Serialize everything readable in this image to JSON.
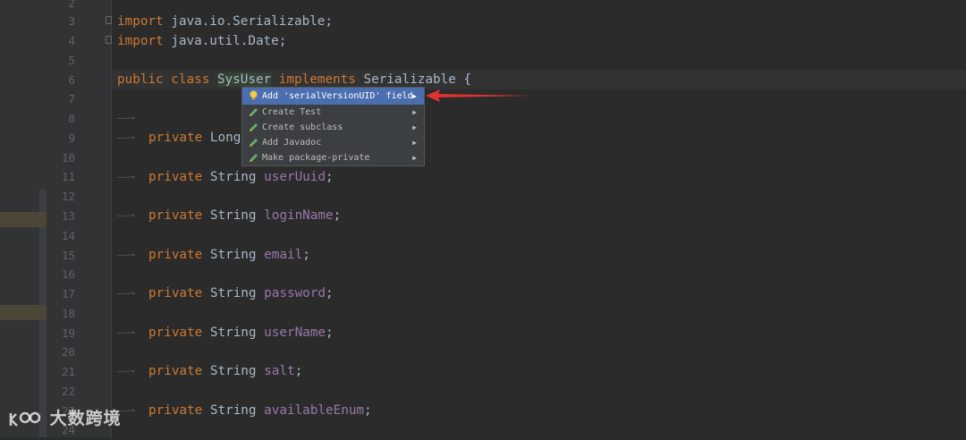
{
  "editor": {
    "line_numbers": [
      "2",
      "3",
      "4",
      "5",
      "6",
      "7",
      "8",
      "9",
      "10",
      "11",
      "12",
      "13",
      "14",
      "15",
      "16",
      "17",
      "18",
      "19",
      "20",
      "21",
      "22",
      "23",
      "24"
    ],
    "lines": {
      "l3": {
        "kw": "import",
        "rest": " java.io.Serializable;"
      },
      "l4": {
        "kw": "import",
        "rest": " java.util.Date;"
      },
      "l6": {
        "kw1": "public",
        "kw2": "class",
        "classname": "SysUser",
        "kw3": "implements",
        "rest": " Serializable {"
      },
      "l9": {
        "kw": "private",
        "type": " Long"
      },
      "l11": {
        "kw": "private",
        "type": " String ",
        "field": "userUuid",
        "end": ";"
      },
      "l13": {
        "kw": "private",
        "type": " String ",
        "field": "loginName",
        "end": ";"
      },
      "l15": {
        "kw": "private",
        "type": " String ",
        "field": "email",
        "end": ";"
      },
      "l17": {
        "kw": "private",
        "type": " String ",
        "field": "password",
        "end": ";"
      },
      "l19": {
        "kw": "private",
        "type": " String ",
        "field": "userName",
        "end": ";"
      },
      "l21": {
        "kw": "private",
        "type": " String ",
        "field": "salt",
        "end": ";"
      },
      "l23": {
        "kw": "private",
        "type": " String ",
        "field": "availableEnum",
        "end": ";"
      }
    },
    "tab_arrow": "——→"
  },
  "intention_popup": {
    "items": [
      {
        "label": "Add 'serialVersionUID' field",
        "icon": "bulb-icon",
        "selected": true
      },
      {
        "label": "Create Test",
        "icon": "edit-icon",
        "selected": false
      },
      {
        "label": "Create subclass",
        "icon": "edit-icon",
        "selected": false
      },
      {
        "label": "Add Javadoc",
        "icon": "edit-icon",
        "selected": false
      },
      {
        "label": "Make package-private",
        "icon": "edit-icon",
        "selected": false
      }
    ],
    "submenu_glyph": "▶"
  },
  "watermark": {
    "text": "大数跨境",
    "logo_icon": "logo-icon"
  },
  "colors": {
    "background": "#2b2b2b",
    "keyword": "#cc7832",
    "field": "#9876aa",
    "text": "#a9b7c6",
    "selection": "#4b6eaf",
    "annotation_arrow": "#e03131"
  }
}
